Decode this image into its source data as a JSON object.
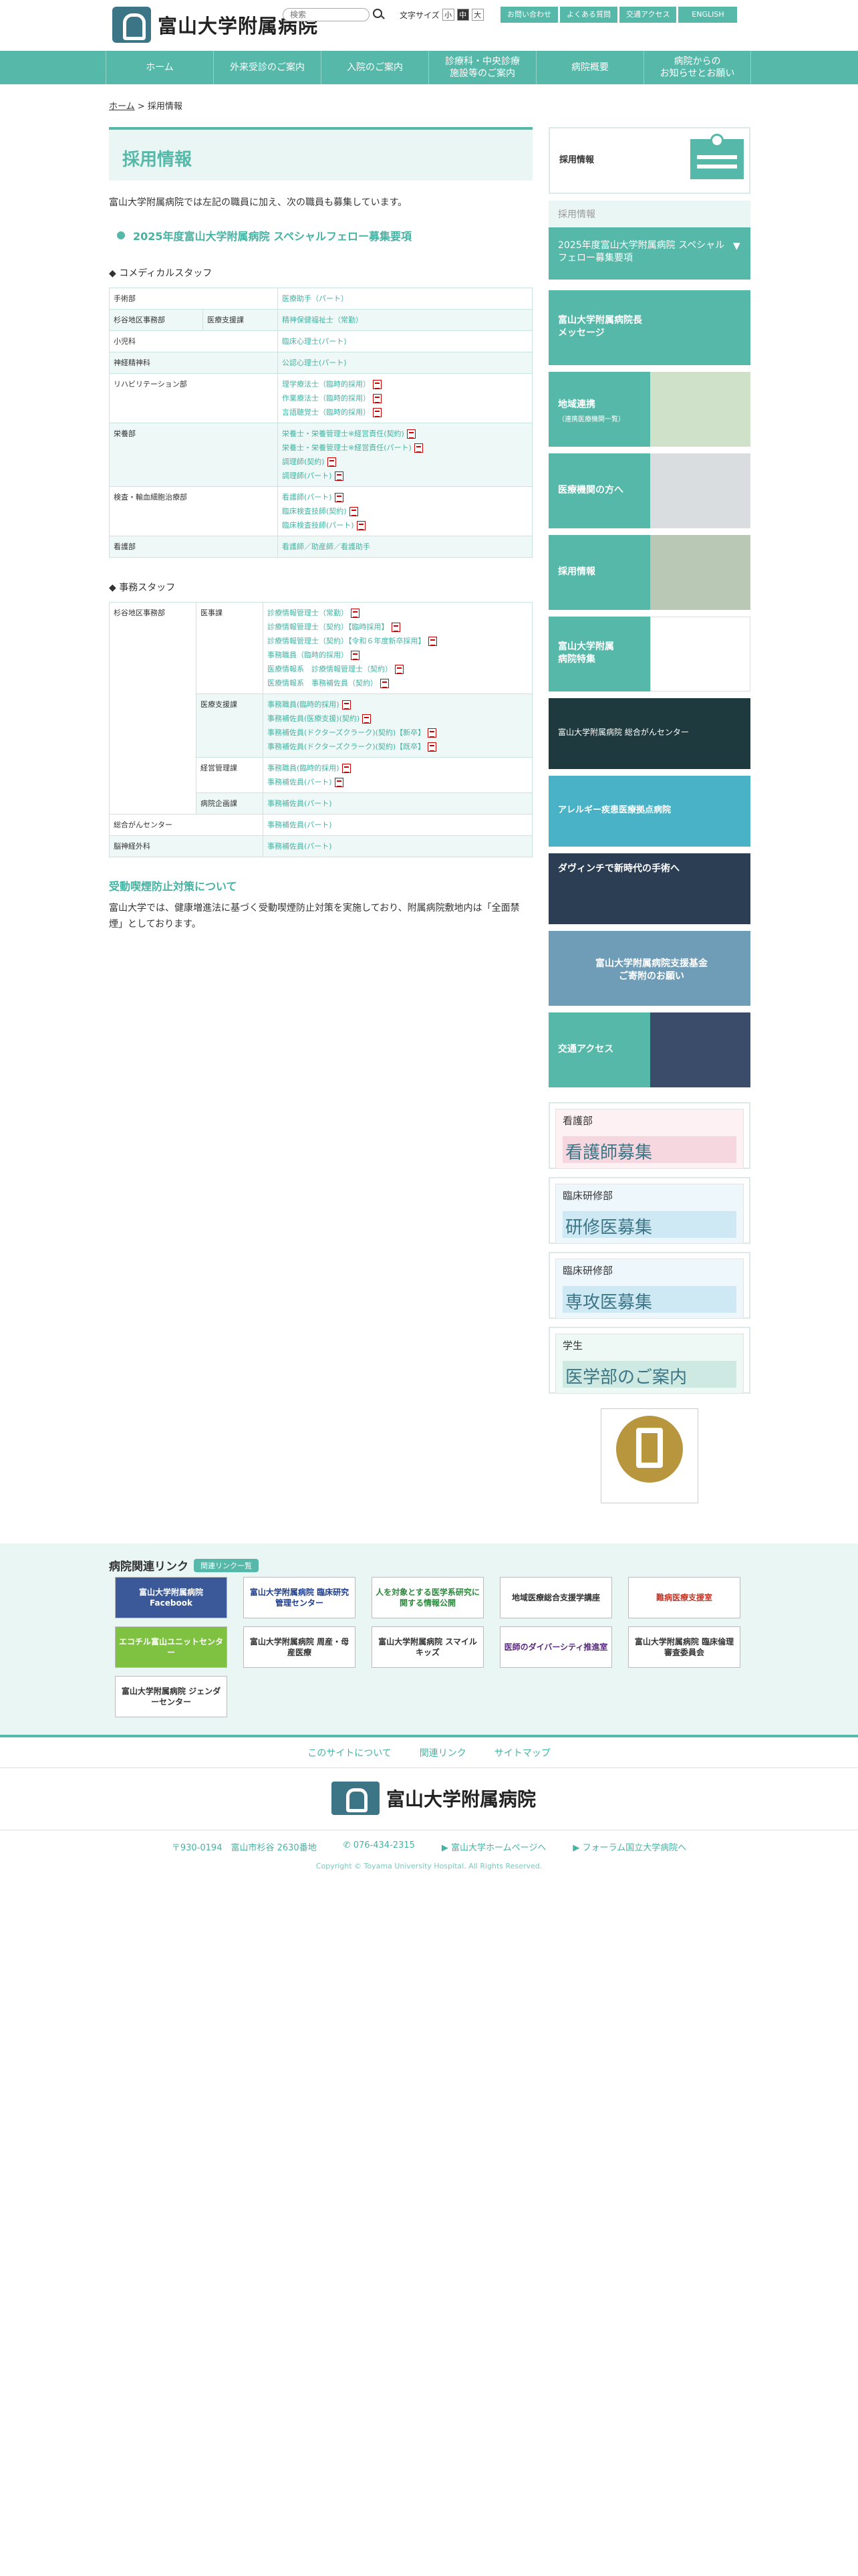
{
  "header": {
    "logo_text": "富山大学附属病院",
    "search_placeholder": "検索",
    "font_size_label": "文字サイズ",
    "font_sizes": [
      "小",
      "中",
      "大"
    ],
    "links": [
      "お問い合わせ",
      "よくある質問",
      "交通アクセス",
      "ENGLISH"
    ]
  },
  "nav": {
    "items": [
      "ホーム",
      "外来受診のご案内",
      "入院のご案内",
      "診療科・中央診療\n施設等のご案内",
      "病院概要",
      "病院からの\nお知らせとお願い"
    ]
  },
  "breadcrumb": {
    "home": "ホーム",
    "separator": ">",
    "current": "採用情報"
  },
  "main": {
    "title": "採用情報",
    "intro": "富山大学附属病院では左記の職員に加え、次の職員も募集しています。",
    "recruit_link": "2025年度富山大学附属病院 スペシャルフェロー募集要項",
    "comedical_heading": "◆ コメディカルスタッフ",
    "comedical": [
      {
        "dept": "手術部",
        "sub": "",
        "jobs": [
          {
            "t": "医療助手（パート）",
            "pdf": false
          }
        ]
      },
      {
        "dept": "杉谷地区事務部",
        "sub": "医療支援課",
        "jobs": [
          {
            "t": "精神保健福祉士（常勤）",
            "pdf": false
          }
        ]
      },
      {
        "dept": "小児科",
        "sub": "",
        "jobs": [
          {
            "t": "臨床心理士(パート)",
            "pdf": false
          }
        ]
      },
      {
        "dept": "神経精神科",
        "sub": "",
        "jobs": [
          {
            "t": "公認心理士(パート)",
            "pdf": false
          }
        ]
      },
      {
        "dept": "リハビリテーション部",
        "sub": "",
        "jobs": [
          {
            "t": "理学療法士（臨時的採用）",
            "pdf": true
          },
          {
            "t": "作業療法士（臨時的採用）",
            "pdf": true
          },
          {
            "t": "言語聴覚士（臨時的採用）",
            "pdf": true
          }
        ]
      },
      {
        "dept": "栄養部",
        "sub": "",
        "jobs": [
          {
            "t": "栄養士・栄養管理士※経営責任(契約)",
            "pdf": true
          },
          {
            "t": "栄養士・栄養管理士※経営責任(パート)",
            "pdf": true
          },
          {
            "t": "調理師(契約)",
            "pdf": true
          },
          {
            "t": "調理師(パート)",
            "pdf": true
          }
        ]
      },
      {
        "dept": "検査・輸血細胞治療部",
        "sub": "",
        "jobs": [
          {
            "t": "看護師(パート)",
            "pdf": true
          },
          {
            "t": "臨床検査技師(契約)",
            "pdf": true
          },
          {
            "t": "臨床検査技師(パート)",
            "pdf": true
          }
        ]
      },
      {
        "dept": "看護部",
        "sub": "",
        "jobs": [
          {
            "t": "看護師／助産師／看護助手",
            "pdf": false
          }
        ]
      }
    ],
    "office_heading": "◆ 事務スタッフ",
    "office_dept": "杉谷地区事務部",
    "office": [
      {
        "sub": "医事課",
        "jobs": [
          {
            "t": "診療情報管理士（常勤）",
            "pdf": true
          },
          {
            "t": "診療情報管理士（契約）【臨時採用】",
            "pdf": true
          },
          {
            "t": "診療情報管理士（契約）【令和６年度新卒採用】",
            "pdf": true
          },
          {
            "t": "事務職員（臨時的採用）",
            "pdf": true
          },
          {
            "t": "医療情報系　診療情報管理士（契約）",
            "pdf": true
          },
          {
            "t": "医療情報系　事務補佐員（契約）",
            "pdf": true
          }
        ]
      },
      {
        "sub": "医療支援課",
        "jobs": [
          {
            "t": "事務職員(臨時的採用)",
            "pdf": true
          },
          {
            "t": "事務補佐員(医療支援)(契約)",
            "pdf": true
          },
          {
            "t": "事務補佐員(ドクターズクラーク)(契約)【新卒】",
            "pdf": true
          },
          {
            "t": "事務補佐員(ドクターズクラーク)(契約)【既卒】",
            "pdf": true
          }
        ]
      },
      {
        "sub": "経営管理課",
        "jobs": [
          {
            "t": "事務職員(臨時的採用)",
            "pdf": true
          },
          {
            "t": "事務補佐員(パート)",
            "pdf": true
          }
        ]
      },
      {
        "sub": "病院企画課",
        "jobs": [
          {
            "t": "事務補佐員(パート)",
            "pdf": false
          }
        ]
      }
    ],
    "office_extra": [
      {
        "dept": "総合がんセンター",
        "jobs": [
          {
            "t": "事務補佐員(パート)",
            "pdf": false
          }
        ]
      },
      {
        "dept": "脳神経外科",
        "jobs": [
          {
            "t": "事務補佐員(パート)",
            "pdf": false
          }
        ]
      }
    ],
    "smoke_title": "受動喫煙防止対策について",
    "smoke_text": "富山大学では、健康増進法に基づく受動喫煙防止対策を実施しており、附属病院敷地内は「全面禁煙」としております。"
  },
  "sidebar": {
    "recruit_title": "採用情報",
    "sub_label": "採用情報",
    "sub_link": "2025年度富山大学附属病院 スペシャルフェロー募集要項",
    "message": "富山大学附属病院長\nメッセージ",
    "regional": "地域連携",
    "regional_sub": "（連携医療機関一覧）",
    "medical": "医療機関の方へ",
    "recruit": "採用情報",
    "feature": "富山大学附属\n病院特集",
    "cancer_text": "富山大学附属病院 総合がんセンター",
    "allergy": "アレルギー疾患医療拠点病院",
    "davinci": "ダヴィンチで新時代の手術へ",
    "support": "富山大学附属病院支援基金\nご寄附のお願い",
    "access": "交通アクセス",
    "cards": [
      {
        "sm": "看護部",
        "lg": "看護師募集"
      },
      {
        "sm": "臨床研修部",
        "lg": "研修医募集"
      },
      {
        "sm": "臨床研修部",
        "lg": "専攻医募集"
      },
      {
        "sm": "学生",
        "lg": "医学部のご案内"
      }
    ]
  },
  "related": {
    "title": "病院関連リンク",
    "badge": "関連リンク一覧",
    "items": [
      "富山大学附属病院 Facebook",
      "富山大学附属病院 臨床研究管理センター",
      "人を対象とする医学系研究に関する情報公開",
      "地域医療総合支援学講座",
      "難病医療支援室",
      "エコチル富山ユニットセンター",
      "富山大学附属病院 周産・母産医療",
      "富山大学附属病院 スマイルキッズ",
      "医師のダイバーシティ推進室",
      "富山大学附属病院 臨床倫理審査委員会",
      "富山大学附属病院 ジェンダーセンター"
    ]
  },
  "footer": {
    "links": [
      "このサイトについて",
      "関連リンク",
      "サイトマップ"
    ],
    "logo_text": "富山大学附属病院",
    "address": "〒930-0194　富山市杉谷 2630番地",
    "tel": "076-434-2315",
    "univ_link": "富山大学ホームページへ",
    "forum_link": "フォーラム国立大学病院へ",
    "copyright": "Copyright © Toyama University Hospital. All Rights Reserved."
  },
  "colors": {
    "accent": "#55b8a8",
    "link": "#45b3a3",
    "dark": "#3c7686"
  }
}
